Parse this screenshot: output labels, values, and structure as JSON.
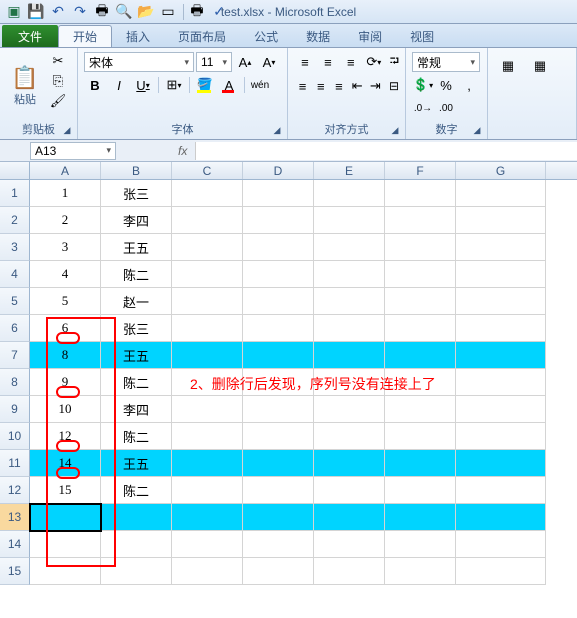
{
  "qat": {
    "title": "test.xlsx - Microsoft Excel",
    "icons": [
      "excel",
      "save",
      "undo",
      "redo",
      "print",
      "preview",
      "open",
      "new",
      "sep",
      "quick-print",
      "spelling"
    ]
  },
  "tabs": {
    "file": "文件",
    "items": [
      "开始",
      "插入",
      "页面布局",
      "公式",
      "数据",
      "审阅",
      "视图"
    ],
    "active": 0
  },
  "ribbon": {
    "clipboard": {
      "label": "剪贴板",
      "paste": "粘贴"
    },
    "font": {
      "label": "字体",
      "name": "宋体",
      "size": "11"
    },
    "alignment": {
      "label": "对齐方式"
    },
    "number": {
      "label": "数字",
      "format": "常规"
    }
  },
  "formula_bar": {
    "namebox": "A13",
    "fx": "fx",
    "input": ""
  },
  "columns": [
    "A",
    "B",
    "C",
    "D",
    "E",
    "F",
    "G"
  ],
  "selected_row": 13,
  "rows": [
    {
      "n": 1,
      "a": "1",
      "b": "张三",
      "hl": false
    },
    {
      "n": 2,
      "a": "2",
      "b": "李四",
      "hl": false
    },
    {
      "n": 3,
      "a": "3",
      "b": "王五",
      "hl": false
    },
    {
      "n": 4,
      "a": "4",
      "b": "陈二",
      "hl": false
    },
    {
      "n": 5,
      "a": "5",
      "b": "赵一",
      "hl": false
    },
    {
      "n": 6,
      "a": "6",
      "b": "张三",
      "hl": false
    },
    {
      "n": 7,
      "a": "8",
      "b": "王五",
      "hl": true
    },
    {
      "n": 8,
      "a": "9",
      "b": "陈二",
      "hl": false
    },
    {
      "n": 9,
      "a": "10",
      "b": "李四",
      "hl": false
    },
    {
      "n": 10,
      "a": "12",
      "b": "陈二",
      "hl": false
    },
    {
      "n": 11,
      "a": "14",
      "b": "王五",
      "hl": true
    },
    {
      "n": 12,
      "a": "15",
      "b": "陈二",
      "hl": false
    },
    {
      "n": 13,
      "a": "",
      "b": "",
      "hl": true
    },
    {
      "n": 14,
      "a": "",
      "b": "",
      "hl": false
    },
    {
      "n": 15,
      "a": "",
      "b": "",
      "hl": false
    }
  ],
  "annotation": "2、删除行后发现，序列号没有连接上了"
}
